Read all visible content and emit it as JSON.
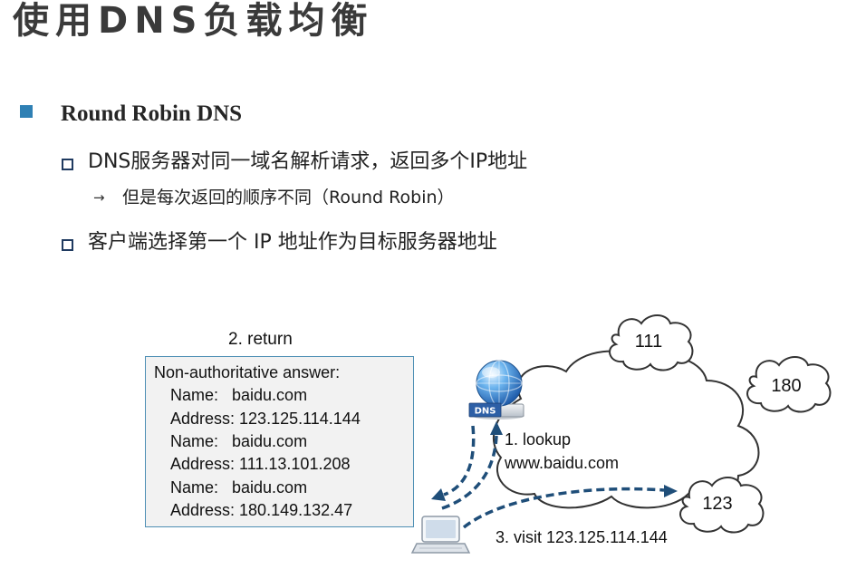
{
  "slide": {
    "title": "使用DNS负载均衡",
    "heading": "Round Robin DNS",
    "items": [
      {
        "text": "DNS服务器对同一域名解析请求，返回多个IP地址",
        "sub": {
          "marker": "→",
          "text": "但是每次返回的顺序不同（Round Robin）"
        }
      },
      {
        "text": "客户端选择第一个 IP 地址作为目标服务器地址"
      }
    ]
  },
  "diagram": {
    "return_label": "2. return",
    "answer": {
      "header": "Non-authoritative answer:",
      "lines": [
        "Name:   baidu.com",
        "Address: 123.125.114.144",
        "Name:   baidu.com",
        "Address: 111.13.101.208",
        "Name:   baidu.com",
        "Address: 180.149.132.47"
      ]
    },
    "dns_tag": "DNS",
    "lookup_label": "1. lookup",
    "lookup_domain": "www.baidu.com",
    "visit_label": "3. visit 123.125.114.144",
    "clouds": [
      "111",
      "180",
      "123"
    ]
  },
  "colors": {
    "title": "#3a3a3a",
    "bullet_accent": "#2f80b4",
    "sub_bullet": "#1f3a60",
    "arrow": "#1f4e79",
    "answer_box_fill": "#f2f2f2",
    "answer_box_border": "#4e8fb4",
    "dns_tag": "#2d5fa6"
  },
  "icons": {
    "heading_bullet": "filled-square-icon",
    "item_bullet": "hollow-square-icon",
    "dns_server": "globe-icon",
    "client": "laptop-icon"
  }
}
